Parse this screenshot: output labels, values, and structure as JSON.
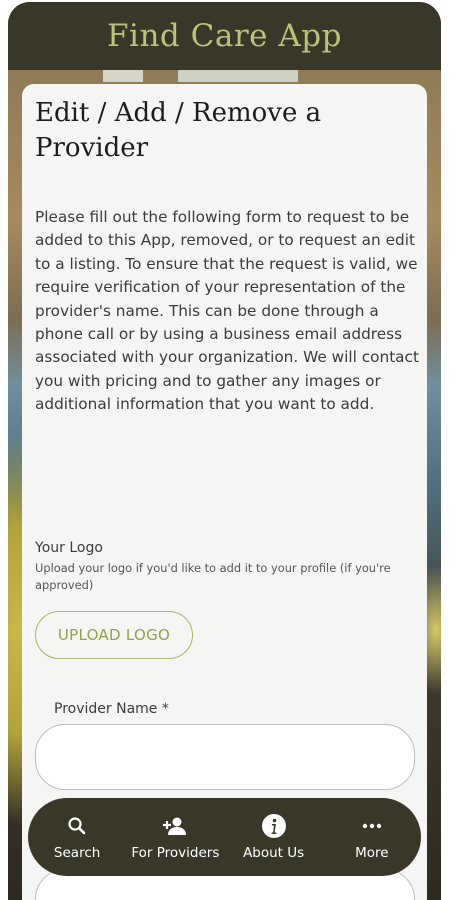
{
  "app": {
    "title": "Find Care App"
  },
  "form": {
    "title": "Edit / Add / Remove a Provider",
    "intro": "Please fill out the following form to request to be added to this App, removed, or to request an edit to a listing. To ensure that the request is valid, we require verification of your representation of the provider's name. This can be done through a phone call or by using a business email address associated with your organization. We will contact you with pricing and to gather any images or additional information that you want to add.",
    "logo": {
      "label": "Your Logo",
      "help": "Upload your logo if you'd like to add it to your profile (if you're approved)",
      "button": "UPLOAD LOGO"
    },
    "provider_name": {
      "label": "Provider Name *",
      "value": ""
    }
  },
  "nav": {
    "items": [
      {
        "label": "Search",
        "icon": "search-icon"
      },
      {
        "label": "For Providers",
        "icon": "add-person-icon"
      },
      {
        "label": "About Us",
        "icon": "info-icon"
      },
      {
        "label": "More",
        "icon": "more-icon"
      }
    ]
  },
  "colors": {
    "header_bg": "#393828",
    "accent": "#b9c37a",
    "button_accent": "#8fa44a"
  }
}
